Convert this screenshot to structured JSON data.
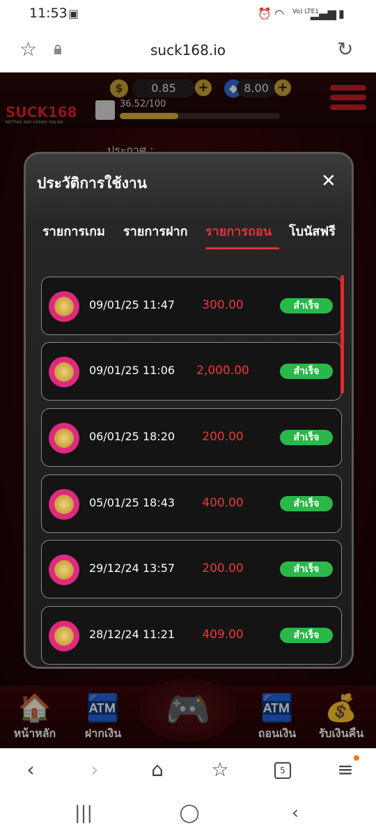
{
  "status_bar": {
    "time": "11:53",
    "network_label": "Vo) LTE1"
  },
  "browser": {
    "url": "suck168.io",
    "tab_count": "5"
  },
  "site": {
    "coin_balance": "0.85",
    "gem_balance": "8.00",
    "logo_text": "SUCK168",
    "logo_tagline": "BETTING AND CASINO ONLINE",
    "level_progress": "36.52/100",
    "level_fraction": 0.3652,
    "announcement_label": "ประกาศ :"
  },
  "bottom_nav": {
    "home": "หน้าหลัก",
    "deposit": "ฝากเงิน",
    "withdraw": "ถอนเงิน",
    "cashback": "รับเงินคืน"
  },
  "modal": {
    "title": "ประวัติการใช้งาน",
    "tabs": [
      "รายการเกม",
      "รายการฝาก",
      "รายการถอน",
      "โบนัสฟรี"
    ],
    "active_tab_index": 2,
    "rows": [
      {
        "datetime": "09/01/25 11:47",
        "amount": "300.00",
        "status": "สำเร็จ"
      },
      {
        "datetime": "09/01/25 11:06",
        "amount": "2,000.00",
        "status": "สำเร็จ"
      },
      {
        "datetime": "06/01/25 18:20",
        "amount": "200.00",
        "status": "สำเร็จ"
      },
      {
        "datetime": "05/01/25 18:43",
        "amount": "400.00",
        "status": "สำเร็จ"
      },
      {
        "datetime": "29/12/24 13:57",
        "amount": "200.00",
        "status": "สำเร็จ"
      },
      {
        "datetime": "28/12/24 11:21",
        "amount": "409.00",
        "status": "สำเร็จ"
      }
    ]
  },
  "colors": {
    "accent_red": "#e5333a",
    "success_green": "#2bb84a",
    "amount_red": "#ea3b3b"
  }
}
